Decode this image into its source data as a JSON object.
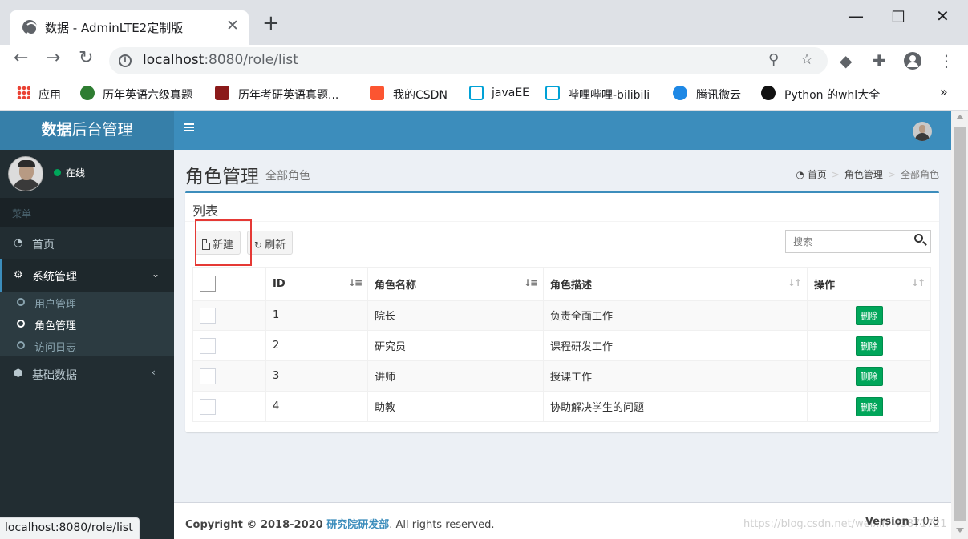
{
  "browser": {
    "tab_title": "数据 - AdminLTE2定制版",
    "tab_close": "✕",
    "new_tab": "+",
    "url_host": "localhost",
    "url_rest": ":8080/role/list",
    "bookmarks": [
      {
        "label": "应用",
        "icon": "apps-icon"
      },
      {
        "label": "历年英语六级真题",
        "icon": "bookmark-green-icon"
      },
      {
        "label": "历年考研英语真题...",
        "icon": "book-icon"
      },
      {
        "label": "我的CSDN",
        "icon": "csdn-icon"
      },
      {
        "label": "javaEE",
        "icon": "bilibili-icon"
      },
      {
        "label": "哔哩哔哩-bilibili",
        "icon": "bilibili-icon"
      },
      {
        "label": "腾讯微云",
        "icon": "weiyun-icon"
      },
      {
        "label": "Python 的whl大全",
        "icon": "python-icon"
      }
    ],
    "bookmarks_more": "»",
    "status_url": "localhost:8080/role/list"
  },
  "app": {
    "logo_bold": "数据",
    "logo_rest": "后台管理",
    "user_status": "在线",
    "menu_header": "菜单",
    "menu": {
      "home": "首页",
      "system": "系统管理",
      "sub_users": "用户管理",
      "sub_roles": "角色管理",
      "sub_logs": "访问日志",
      "basic_data": "基础数据"
    }
  },
  "page": {
    "title": "角色管理",
    "subtitle": "全部角色",
    "breadcrumb": [
      "首页",
      "角色管理",
      "全部角色"
    ],
    "box_title": "列表",
    "new_button": "新建",
    "refresh_button": "刷新",
    "search_placeholder": "搜索",
    "columns": [
      "ID",
      "角色名称",
      "角色描述",
      "操作"
    ],
    "rows": [
      {
        "id": "1",
        "name": "院长",
        "desc": "负责全面工作",
        "action": "删除"
      },
      {
        "id": "2",
        "name": "研究员",
        "desc": "课程研发工作",
        "action": "删除"
      },
      {
        "id": "3",
        "name": "讲师",
        "desc": "授课工作",
        "action": "删除"
      },
      {
        "id": "4",
        "name": "助教",
        "desc": "协助解决学生的问题",
        "action": "删除"
      }
    ]
  },
  "footer": {
    "copyright_prefix": "Copyright © 2018-2020 ",
    "org": "研究院研发部",
    "suffix": ". All rights reserved.",
    "version_label": "Version",
    "version": "1.0.8",
    "watermark": "https://blog.csdn.net/weixin_43871721"
  },
  "colors": {
    "primary": "#3c8dbc",
    "logo_bg": "#367fa9",
    "sidebar": "#222d32",
    "success": "#00a65a",
    "highlight": "#e53935"
  }
}
